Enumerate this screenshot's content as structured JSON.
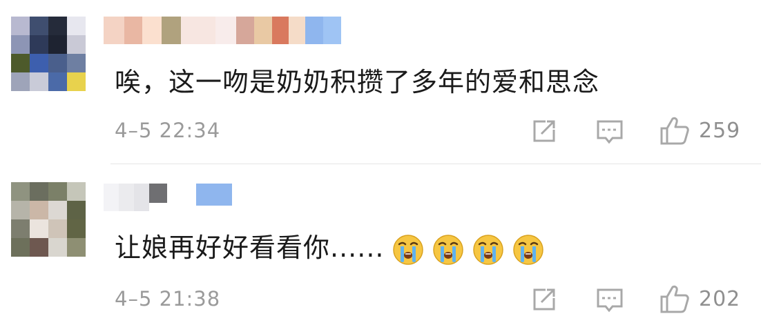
{
  "comments": [
    {
      "text": "唉，这一吻是奶奶积攒了多年的爱和思念",
      "timestamp": "4–5 22:34",
      "likes": "259",
      "icons": [
        "share-icon",
        "comment-icon",
        "thumbs-up-icon"
      ],
      "avatar_colors": [
        "#b8b9d0",
        "#3f4e6f",
        "#252b3a",
        "#e7e7ef",
        "#8d95b5",
        "#2e3a59",
        "#1e2331",
        "#c9c9d6",
        "#4d5a2b",
        "#3d5fae",
        "#4a5f8c",
        "#6e7fa2",
        "#9ea4b9",
        "#c9cbd8",
        "#4b6aa8",
        "#e8d24d"
      ],
      "name_colors": [
        "#f4d3c4",
        "#e9b7a3",
        "#fbe0cf",
        "#b0a27e",
        "#f7e6e1",
        "#f8eceb",
        "#d6a79a",
        "#e9c9a4",
        "#d9795e",
        "#f5dcc8",
        "#8fb6ee",
        "#9fc4f4"
      ]
    },
    {
      "text": "让娘再好好看看你......",
      "timestamp": "4–5 21:38",
      "likes": "202",
      "icons": [
        "share-icon",
        "comment-icon",
        "thumbs-up-icon"
      ],
      "emojis": [
        "crying-face-emoji",
        "crying-face-emoji",
        "crying-face-emoji",
        "crying-face-emoji"
      ],
      "avatar_colors": [
        "#8f9380",
        "#6b6e5f",
        "#7b8068",
        "#c5c6b9",
        "#b6b4a9",
        "#cbb7a7",
        "#dcd8d3",
        "#5e6346",
        "#7d7e6f",
        "#ebe4de",
        "#cfc4b8",
        "#616545",
        "#6d705b",
        "#6e5850",
        "#d9d6cf",
        "#8e8f73"
      ],
      "name_colors": [
        "#f3f3f6",
        "#ebebee",
        "#e4e4e8",
        "#6f6f72",
        "#ffffff",
        "#8fb6ee"
      ]
    }
  ]
}
